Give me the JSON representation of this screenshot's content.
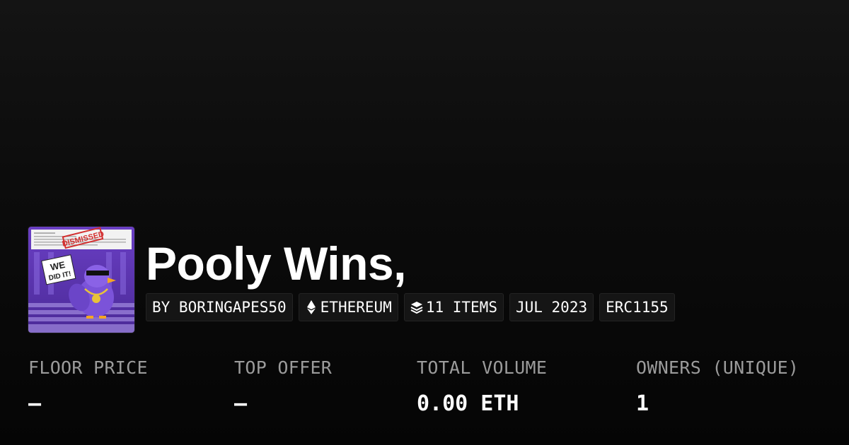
{
  "collection": {
    "title": "Pooly Wins,",
    "image_icon": "pooly-bird-collection-image",
    "image_text": {
      "sign": "WE DID IT!",
      "stamp": "DISMISSED"
    }
  },
  "chips": {
    "creator": "BY BORINGAPES50",
    "chain": "ETHEREUM",
    "chain_icon": "ethereum-icon",
    "items": "11 ITEMS",
    "items_icon": "layers-icon",
    "date": "JUL 2023",
    "standard": "ERC1155"
  },
  "stats": {
    "floor_price": {
      "label": "FLOOR PRICE",
      "value": "—"
    },
    "top_offer": {
      "label": "TOP OFFER",
      "value": "—"
    },
    "total_volume": {
      "label": "TOTAL VOLUME",
      "value": "0.00 ETH"
    },
    "owners": {
      "label": "OWNERS (UNIQUE)",
      "value": "1"
    }
  },
  "colors": {
    "background": "#0a0a0a",
    "chip_background": "#151515",
    "label": "#9b9b9b",
    "image_purple": "#7a4fd6"
  }
}
